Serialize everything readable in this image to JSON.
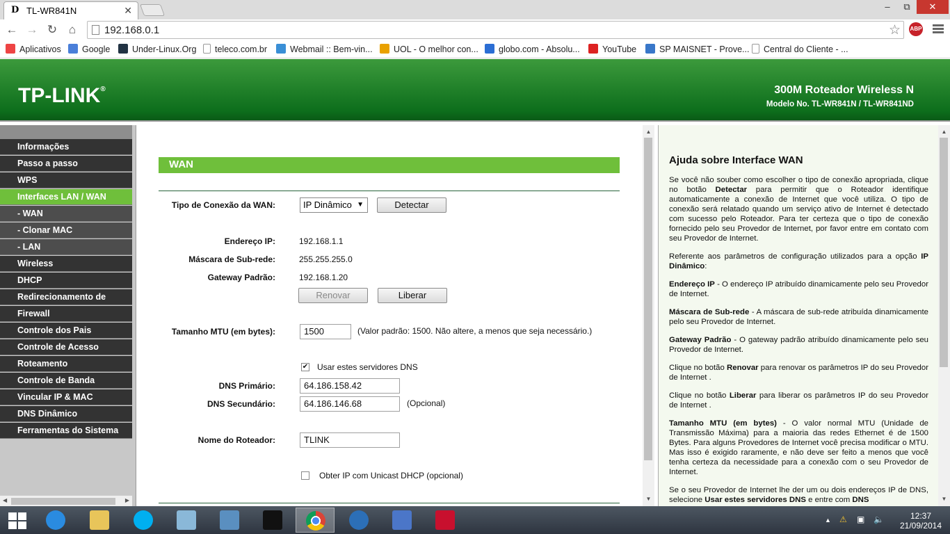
{
  "browser": {
    "tab_title": "TL-WR841N",
    "tab_favicon": "D",
    "url": "192.168.0.1",
    "abp_label": "ABP",
    "window_buttons": {
      "minimize": "‒",
      "restore": "⧉",
      "close": "✕"
    }
  },
  "bookmarks": [
    {
      "label": "Aplicativos",
      "icon": "apps-grid-icon",
      "color": "#e44"
    },
    {
      "label": "Google",
      "icon": "google-icon",
      "color": "#4a7fd9"
    },
    {
      "label": "Under-Linux.Org",
      "icon": "under-linux-icon",
      "color": "#234"
    },
    {
      "label": "teleco.com.br",
      "icon": "page-icon",
      "color": "#ddd"
    },
    {
      "label": "Webmail :: Bem-vin...",
      "icon": "webmail-icon",
      "color": "#3a8fd6"
    },
    {
      "label": "UOL - O melhor con...",
      "icon": "uol-icon",
      "color": "#e9a100"
    },
    {
      "label": "globo.com - Absolu...",
      "icon": "globo-icon",
      "color": "#2b6ed4"
    },
    {
      "label": "YouTube",
      "icon": "youtube-icon",
      "color": "#d22"
    },
    {
      "label": "SP MAISNET - Prove...",
      "icon": "spmaisnet-icon",
      "color": "#3977c9"
    },
    {
      "label": "Central do Cliente - ...",
      "icon": "page-icon",
      "color": "#ddd"
    }
  ],
  "header": {
    "logo": "TP-LINK",
    "product_name": "300M Roteador Wireless N",
    "model": "Modelo No. TL-WR841N / TL-WR841ND"
  },
  "sidebar": {
    "items": [
      {
        "label": "Informações",
        "state": "normal"
      },
      {
        "label": "Passo a passo",
        "state": "normal"
      },
      {
        "label": "WPS",
        "state": "normal"
      },
      {
        "label": "Interfaces LAN / WAN",
        "state": "active"
      },
      {
        "label": "- WAN",
        "state": "subactive"
      },
      {
        "label": "- Clonar MAC",
        "state": "sub"
      },
      {
        "label": "- LAN",
        "state": "sub"
      },
      {
        "label": "Wireless",
        "state": "normal"
      },
      {
        "label": "DHCP",
        "state": "normal"
      },
      {
        "label": "Redirecionamento de Portas",
        "state": "normal"
      },
      {
        "label": "Firewall",
        "state": "normal"
      },
      {
        "label": "Controle dos Pais",
        "state": "normal"
      },
      {
        "label": "Controle de Acesso",
        "state": "normal"
      },
      {
        "label": "Roteamento",
        "state": "normal"
      },
      {
        "label": "Controle de Banda",
        "state": "normal"
      },
      {
        "label": "Vincular IP & MAC",
        "state": "normal"
      },
      {
        "label": "DNS Dinâmico",
        "state": "normal"
      },
      {
        "label": "Ferramentas do Sistema",
        "state": "normal"
      }
    ]
  },
  "wan": {
    "section_title": "WAN",
    "conn_type_label": "Tipo de Conexão da WAN:",
    "conn_type_value": "IP Dinâmico",
    "detect_button": "Detectar",
    "ip_label": "Endereço IP:",
    "ip_value": "192.168.1.1",
    "mask_label": "Máscara de Sub-rede:",
    "mask_value": "255.255.255.0",
    "gateway_label": "Gateway Padrão:",
    "gateway_value": "192.168.1.20",
    "renew_button": "Renovar",
    "release_button": "Liberar",
    "mtu_label": "Tamanho MTU (em bytes):",
    "mtu_value": "1500",
    "mtu_hint": "(Valor padrão: 1500. Não altere, a menos que seja necessário.)",
    "use_dns_label": "Usar estes servidores DNS",
    "use_dns_checked": true,
    "dns1_label": "DNS Primário:",
    "dns1_value": "64.186.158.42",
    "dns2_label": "DNS Secundário:",
    "dns2_value": "64.186.146.68",
    "dns2_hint": "(Opcional)",
    "hostname_label": "Nome do Roteador:",
    "hostname_value": "TLINK",
    "unicast_label": "Obter IP com Unicast DHCP (opcional)",
    "unicast_checked": false
  },
  "help": {
    "title": "Ajuda sobre Interface WAN",
    "paragraphs": [
      [
        {
          "t": "Se você não souber como escolher o tipo de conexão apropriada, clique no botão "
        },
        {
          "b": "Detectar"
        },
        {
          "t": " para permitir que o Roteador identifique automaticamente a conexão de Internet que você utiliza. O tipo de conexão será relatado quando um serviço ativo de Internet é detectado com sucesso pelo Roteador. Para ter certeza que o tipo de conexão fornecido pelo seu Provedor de Internet, por favor entre em contato com seu Provedor de Internet."
        }
      ],
      [
        {
          "t": "Referente aos parâmetros de configuração utilizados para a opção "
        },
        {
          "b": "IP Dinâmico"
        },
        {
          "t": ":"
        }
      ],
      [
        {
          "b": "Endereço IP"
        },
        {
          "t": " - O endereço IP atribuído dinamicamente pelo seu Provedor de Internet."
        }
      ],
      [
        {
          "b": "Máscara de Sub-rede"
        },
        {
          "t": " - A máscara de sub-rede atribuída dinamicamente pelo seu Provedor de Internet."
        }
      ],
      [
        {
          "b": "Gateway Padrão"
        },
        {
          "t": " - O gateway padrão atribuído dinamicamente pelo seu Provedor de Internet."
        }
      ],
      [
        {
          "t": "Clique no botão "
        },
        {
          "b": "Renovar"
        },
        {
          "t": " para renovar os parâmetros IP do seu Provedor de Internet ."
        }
      ],
      [
        {
          "t": "Clique no botão "
        },
        {
          "b": "Liberar"
        },
        {
          "t": " para liberar os parâmetros IP do seu Provedor de Internet ."
        }
      ],
      [
        {
          "b": "Tamanho MTU (em bytes)"
        },
        {
          "t": " - O valor normal MTU (Unidade de Transmissão Máxima) para a maioria das redes Ethernet é de 1500 Bytes. Para alguns Provedores de Internet você precisa modificar o MTU. Mas isso é exigido raramente, e não deve ser feito a menos que você tenha certeza da necessidade para a conexão com o seu Provedor de Internet."
        }
      ],
      [
        {
          "t": "Se o seu Provedor de Internet lhe der um ou dois endereços IP de DNS, selecione "
        },
        {
          "b": "Usar estes servidores DNS"
        },
        {
          "t": " e entre com "
        },
        {
          "b": "DNS"
        }
      ]
    ]
  },
  "taskbar": {
    "apps": [
      {
        "name": "start-button",
        "color": "#fff"
      },
      {
        "name": "ie-icon",
        "color": "#2a8be0"
      },
      {
        "name": "explorer-icon",
        "color": "#e8c55a"
      },
      {
        "name": "skype-icon",
        "color": "#00aff0"
      },
      {
        "name": "notepad-icon",
        "color": "#8ab8d8"
      },
      {
        "name": "installer-icon",
        "color": "#5a8fc0"
      },
      {
        "name": "cmd-icon",
        "color": "#111"
      },
      {
        "name": "chrome-icon",
        "color": "#db4437",
        "active": true
      },
      {
        "name": "eclipse-icon",
        "color": "#2c6fb7"
      },
      {
        "name": "network-icon",
        "color": "#4b76c8"
      },
      {
        "name": "acrobat-icon",
        "color": "#c8102e"
      }
    ],
    "time": "12:37",
    "date": "21/09/2014"
  }
}
